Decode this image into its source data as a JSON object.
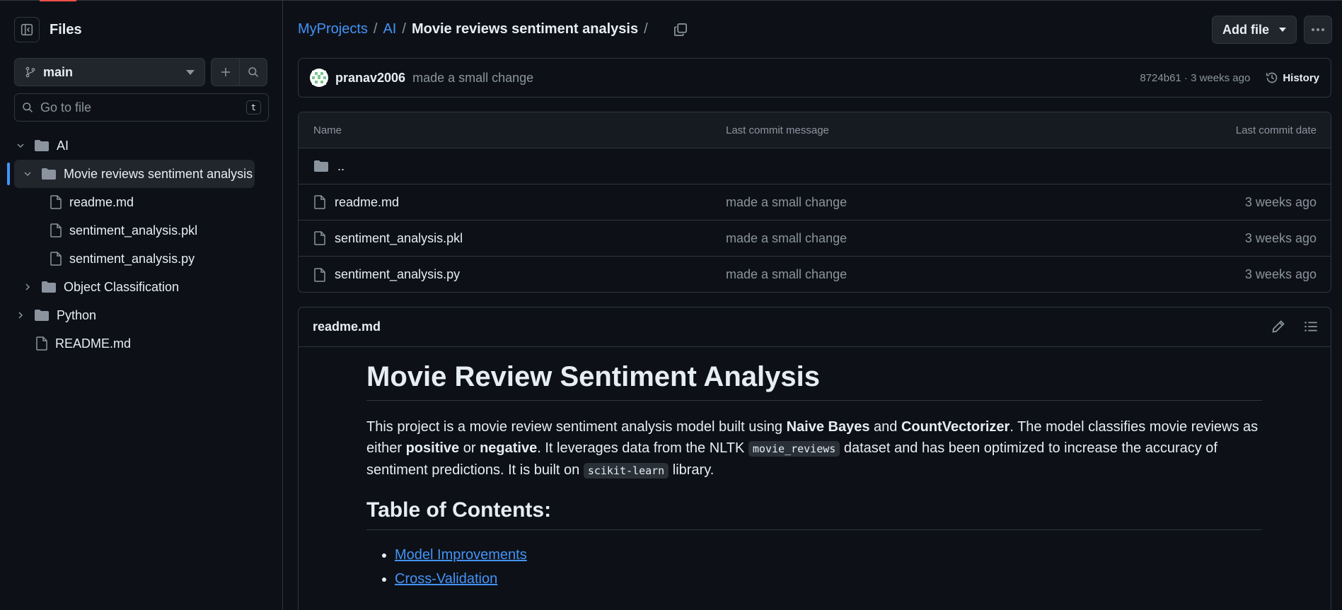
{
  "sidebar": {
    "title": "Files",
    "branch": "main",
    "goto_placeholder": "Go to file",
    "goto_shortcut": "t",
    "tree": [
      {
        "label": "AI",
        "type": "folder",
        "expanded": true
      },
      {
        "label": "Movie reviews sentiment analysis",
        "type": "folder",
        "expanded": true,
        "selected": true
      },
      {
        "label": "readme.md",
        "type": "file"
      },
      {
        "label": "sentiment_analysis.pkl",
        "type": "file"
      },
      {
        "label": "sentiment_analysis.py",
        "type": "file"
      },
      {
        "label": "Object Classification",
        "type": "folder",
        "expanded": false
      },
      {
        "label": "Python",
        "type": "folder",
        "expanded": false
      },
      {
        "label": "README.md",
        "type": "file"
      }
    ]
  },
  "header": {
    "crumbs": [
      "MyProjects",
      "AI"
    ],
    "current": "Movie reviews sentiment analysis",
    "sep": "/",
    "add_file": "Add file"
  },
  "commit": {
    "author": "pranav2006",
    "message": "made a small change",
    "meta": "8724b61 · 3 weeks ago",
    "history": "History"
  },
  "files": {
    "headers": {
      "name": "Name",
      "message": "Last commit message",
      "date": "Last commit date"
    },
    "parent": "..",
    "rows": [
      {
        "name": "readme.md",
        "message": "made a small change",
        "date": "3 weeks ago"
      },
      {
        "name": "sentiment_analysis.pkl",
        "message": "made a small change",
        "date": "3 weeks ago"
      },
      {
        "name": "sentiment_analysis.py",
        "message": "made a small change",
        "date": "3 weeks ago"
      }
    ]
  },
  "readme": {
    "filename": "readme.md",
    "h1": "Movie Review Sentiment Analysis",
    "p": {
      "t1": "This project is a movie review sentiment analysis model built using ",
      "b1": "Naive Bayes",
      "t2": " and ",
      "b2": "CountVectorizer",
      "t3": ". The model classifies movie reviews as either ",
      "b3": "positive",
      "t4": " or ",
      "b4": "negative",
      "t5": ". It leverages data from the NLTK ",
      "c1": "movie_reviews",
      "t6": " dataset and has been optimized to increase the accuracy of sentiment predictions. It is built on ",
      "c2": "scikit-learn",
      "t7": " library."
    },
    "h2": "Table of Contents:",
    "toc": [
      "Model Improvements",
      "Cross-Validation"
    ]
  },
  "colors": {
    "bg": "#0d1117",
    "border": "#30363d",
    "link": "#4493f8",
    "muted": "#8b949e",
    "accent_selected": "#4493f8"
  }
}
